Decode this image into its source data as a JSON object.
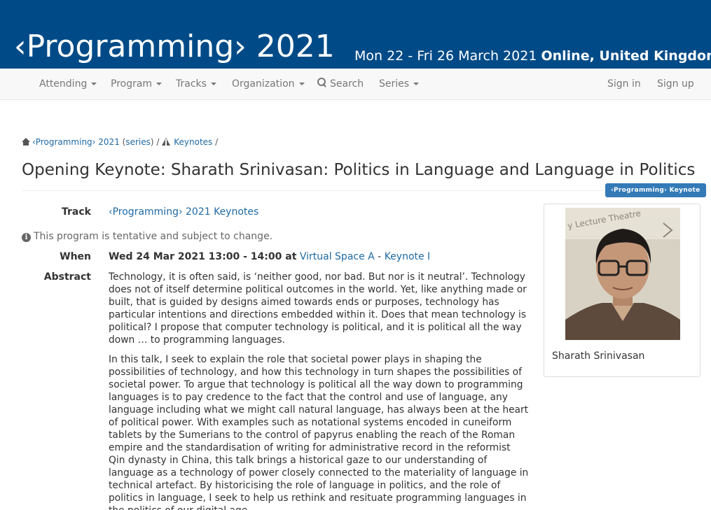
{
  "header": {
    "title": "‹Programming› 2021",
    "dates": "Mon 22 - Fri 26 March 2021",
    "location": "Online, United Kingdom"
  },
  "nav": {
    "attending": "Attending",
    "program": "Program",
    "tracks": "Tracks",
    "organization": "Organization",
    "search": "Search",
    "series": "Series",
    "sign_in": "Sign in",
    "sign_up": "Sign up"
  },
  "breadcrumb": {
    "conference": "‹Programming› 2021",
    "open_paren": " (",
    "series": "series",
    "close_paren": ") / ",
    "section": "Keynotes",
    "trailing": " /"
  },
  "page": {
    "title": "Opening Keynote: Sharath Srinivasan: Politics in Language and Language in Politics",
    "badge": "‹Programming› Keynote"
  },
  "details": {
    "track_label": "Track",
    "track_value": "‹Programming› 2021 Keynotes",
    "tentative_note": "This program is tentative and subject to change.",
    "when_label": "When",
    "when_datetime": "Wed 24 Mar 2021 13:00 - 14:00 at",
    "when_room": "Virtual Space A",
    "when_sep": " - ",
    "when_session": "Keynote I",
    "abstract_label": "Abstract",
    "abstract_p1": "Technology, it is often said, is ‘neither good, nor bad. But nor is it neutral’. Technology does not of itself determine political outcomes in the world. Yet, like anything made or built, that is guided by designs aimed towards ends or purposes, technology has particular intentions and directions embedded within it. Does that mean technology is political? I propose that computer technology is political, and it is political all the way down … to programming languages.",
    "abstract_p2": "In this talk, I seek to explain the role that societal power plays in shaping the possibilities of technology, and how this technology in turn shapes the possibilities of societal power. To argue that technology is political all the way down to programming languages is to pay credence to the fact that the control and use of language, any language including what we might call natural language, has always been at the heart of political power. With examples such as notational systems encoded in cuneiform tablets by the Sumerians to the control of papyrus enabling the reach of the Roman empire and the standardisation of writing for administrative record in the reformist Qin dynasty in China, this talk brings a historical gaze to our understanding of language as a technology of power closely connected to the materiality of language in technical artefact. By historicising the role of language in politics, and the role of politics in language, I seek to help us rethink and resituate programming languages in the politics of our digital age."
  },
  "speaker": {
    "name": "Sharath Srinivasan",
    "photo_sign_text": "y Lecture Theatre"
  },
  "colors": {
    "header_bg": "#004b87",
    "link": "#1f6aa5",
    "badge_bg": "#337ab7"
  }
}
